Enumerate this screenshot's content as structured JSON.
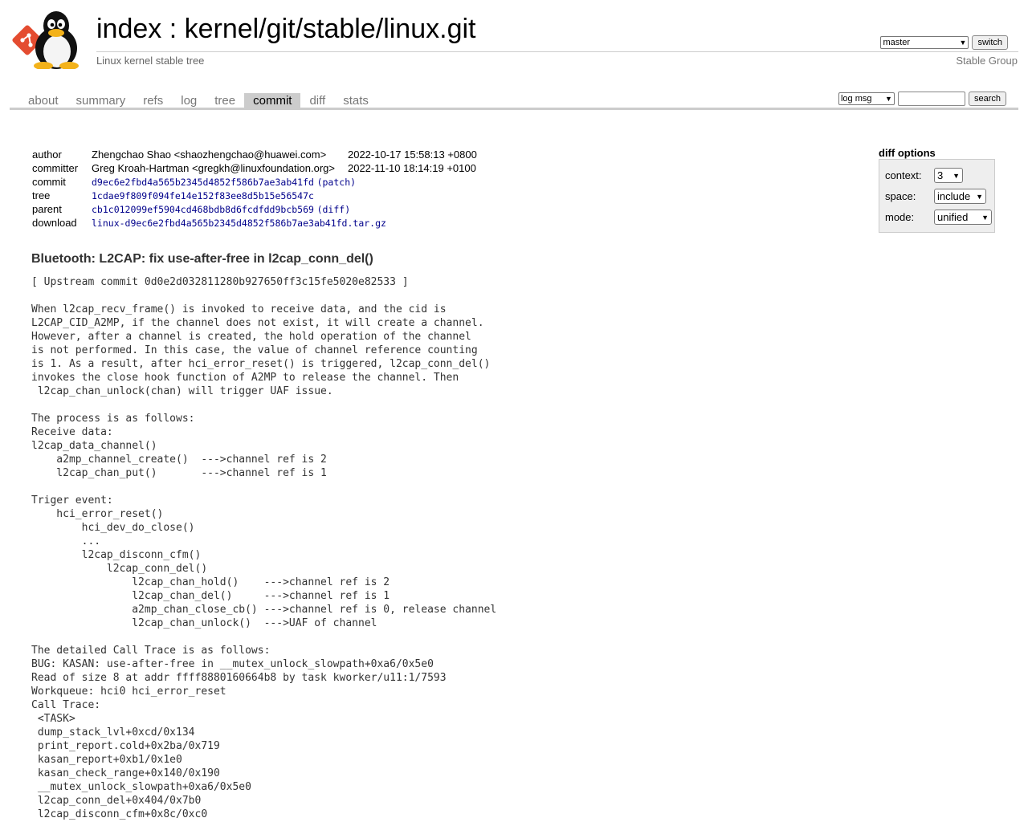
{
  "header": {
    "title_index": "index",
    "title_sep": " : ",
    "title_repo": "kernel/git/stable/linux.git",
    "subtitle": "Linux kernel stable tree",
    "owner": "Stable Group",
    "branch_select": "master",
    "switch_label": "switch"
  },
  "nav": {
    "tabs": [
      {
        "label": "about"
      },
      {
        "label": "summary"
      },
      {
        "label": "refs"
      },
      {
        "label": "log"
      },
      {
        "label": "tree"
      },
      {
        "label": "commit",
        "active": true
      },
      {
        "label": "diff"
      },
      {
        "label": "stats"
      }
    ],
    "search_select": "log msg",
    "search_input": "",
    "search_label": "search"
  },
  "commit_info": {
    "author_label": "author",
    "author": "Zhengchao Shao <shaozhengchao@huawei.com>",
    "author_date": "2022-10-17 15:58:13 +0800",
    "committer_label": "committer",
    "committer": "Greg Kroah-Hartman <gregkh@linuxfoundation.org>",
    "committer_date": "2022-11-10 18:14:19 +0100",
    "commit_label": "commit",
    "commit_hash": "d9ec6e2fbd4a565b2345d4852f586b7ae3ab41fd",
    "commit_extra": "(patch)",
    "tree_label": "tree",
    "tree_hash": "1cdae9f809f094fe14e152f83ee8d5b15e56547c",
    "parent_label": "parent",
    "parent_hash": "cb1c012099ef5904cd468bdb8d6fcdfdd9bcb569",
    "parent_extra": "(diff)",
    "download_label": "download",
    "download_file": "linux-d9ec6e2fbd4a565b2345d4852f586b7ae3ab41fd.tar.gz"
  },
  "diff_options": {
    "title": "diff options",
    "context_label": "context:",
    "context_value": "3",
    "space_label": "space:",
    "space_value": "include",
    "mode_label": "mode:",
    "mode_value": "unified"
  },
  "commit_subject": "Bluetooth: L2CAP: fix use-after-free in l2cap_conn_del()",
  "commit_message": "[ Upstream commit 0d0e2d032811280b927650ff3c15fe5020e82533 ]\n\nWhen l2cap_recv_frame() is invoked to receive data, and the cid is\nL2CAP_CID_A2MP, if the channel does not exist, it will create a channel.\nHowever, after a channel is created, the hold operation of the channel\nis not performed. In this case, the value of channel reference counting\nis 1. As a result, after hci_error_reset() is triggered, l2cap_conn_del()\ninvokes the close hook function of A2MP to release the channel. Then\n l2cap_chan_unlock(chan) will trigger UAF issue.\n\nThe process is as follows:\nReceive data:\nl2cap_data_channel()\n    a2mp_channel_create()  --->channel ref is 2\n    l2cap_chan_put()       --->channel ref is 1\n\nTriger event:\n    hci_error_reset()\n        hci_dev_do_close()\n        ...\n        l2cap_disconn_cfm()\n            l2cap_conn_del()\n                l2cap_chan_hold()    --->channel ref is 2\n                l2cap_chan_del()     --->channel ref is 1\n                a2mp_chan_close_cb() --->channel ref is 0, release channel\n                l2cap_chan_unlock()  --->UAF of channel\n\nThe detailed Call Trace is as follows:\nBUG: KASAN: use-after-free in __mutex_unlock_slowpath+0xa6/0x5e0\nRead of size 8 at addr ffff8880160664b8 by task kworker/u11:1/7593\nWorkqueue: hci0 hci_error_reset\nCall Trace:\n <TASK>\n dump_stack_lvl+0xcd/0x134\n print_report.cold+0x2ba/0x719\n kasan_report+0xb1/0x1e0\n kasan_check_range+0x140/0x190\n __mutex_unlock_slowpath+0xa6/0x5e0\n l2cap_conn_del+0x404/0x7b0\n l2cap_disconn_cfm+0x8c/0xc0"
}
